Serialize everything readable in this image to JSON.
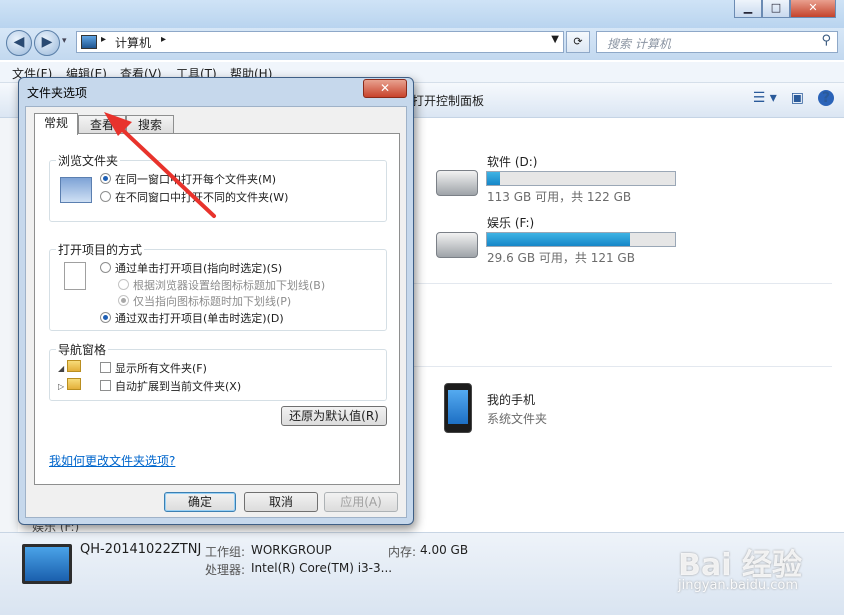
{
  "explorer": {
    "address_path": "计算机",
    "search_placeholder": "搜索 计算机",
    "menu": [
      "文件(F)",
      "编辑(E)",
      "查看(V)",
      "工具(T)",
      "帮助(H)"
    ],
    "cmd_control_panel": "打开控制面板",
    "drives": [
      {
        "name": "软件 (D:)",
        "info": "113 GB 可用，共 122 GB",
        "used_fraction": 0.07
      },
      {
        "name": "娱乐 (F:)",
        "info": "29.6 GB 可用，共 121 GB",
        "used_fraction": 0.76
      }
    ],
    "phone": {
      "name": "我的手机",
      "type": "系统文件夹"
    },
    "behind_item": "娱乐 (F:)",
    "status": {
      "computer_name": "QH-20141022ZTNJ",
      "workgroup_label": "工作组:",
      "workgroup": "WORKGROUP",
      "memory_label": "内存:",
      "memory": "4.00 GB",
      "cpu_label": "处理器:",
      "cpu": "Intel(R) Core(TM) i3-3..."
    },
    "watermark": "Bai 经验",
    "watermark_url": "jingyan.baidu.com"
  },
  "dialog": {
    "title": "文件夹选项",
    "close_label": "✕",
    "tabs": [
      "常规",
      "查看",
      "搜索"
    ],
    "browse_group": {
      "title": "浏览文件夹",
      "options": [
        "在同一窗口中打开每个文件夹(M)",
        "在不同窗口中打开不同的文件夹(W)"
      ],
      "selected": 0
    },
    "click_group": {
      "title": "打开项目的方式",
      "single_click": "通过单击打开项目(指向时选定)(S)",
      "sub_options": [
        "根据浏览器设置给图标标题加下划线(B)",
        "仅当指向图标标题时加下划线(P)"
      ],
      "double_click": "通过双击打开项目(单击时选定)(D)"
    },
    "nav_group": {
      "title": "导航窗格",
      "options": [
        "显示所有文件夹(F)",
        "自动扩展到当前文件夹(X)"
      ]
    },
    "restore_defaults": "还原为默认值(R)",
    "help_link": "我如何更改文件夹选项?",
    "ok": "确定",
    "cancel": "取消",
    "apply": "应用(A)"
  },
  "colors": {
    "annotation_arrow": "#e8332c",
    "drive_bar": "#1586c8"
  }
}
